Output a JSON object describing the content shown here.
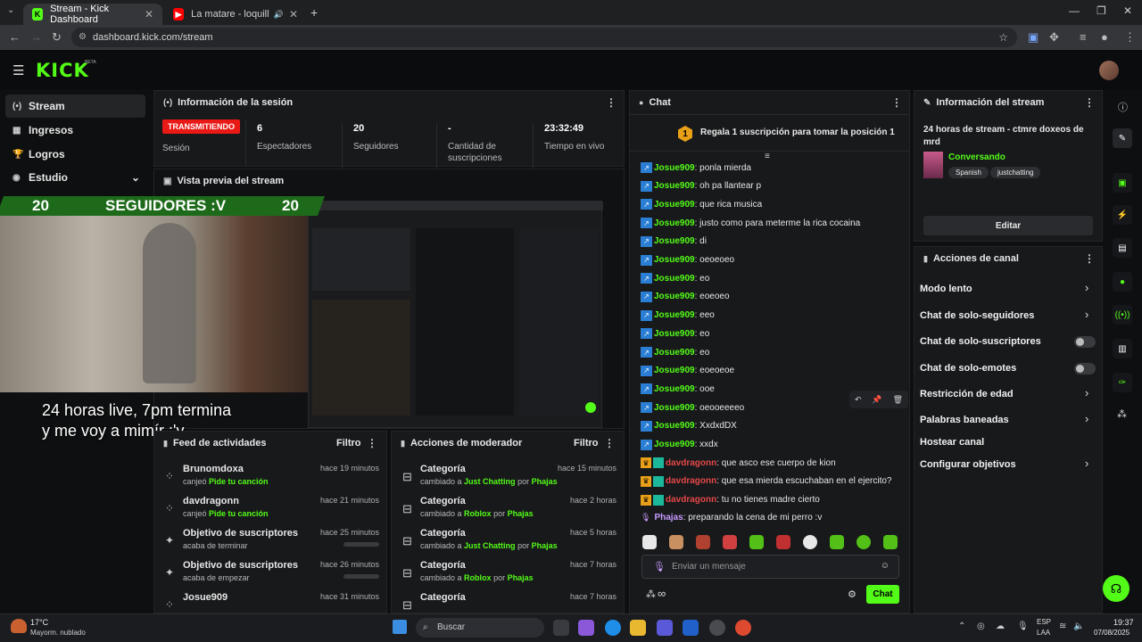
{
  "browser": {
    "tabs": [
      {
        "label": "Stream - Kick Dashboard",
        "icon": "kick-icon"
      },
      {
        "label": "La matare - loquillo y los tr",
        "icon": "youtube-icon"
      }
    ],
    "url": "dashboard.kick.com/stream"
  },
  "header": {
    "logo": "KICK",
    "beta": "BETA"
  },
  "sidebar": {
    "items": [
      {
        "label": "Stream",
        "icon": "stream-icon"
      },
      {
        "label": "Ingresos",
        "icon": "money-icon"
      },
      {
        "label": "Logros",
        "icon": "trophy-icon"
      },
      {
        "label": "Estudio",
        "icon": "studio-icon"
      }
    ]
  },
  "session": {
    "title": "Información de la sesión",
    "status": "TRANSMITIENDO",
    "status_label": "Sesión",
    "stats": [
      {
        "value": "6",
        "label": "Espectadores"
      },
      {
        "value": "20",
        "label": "Seguidores"
      },
      {
        "value": "-",
        "label": "Cantidad de suscripciones"
      },
      {
        "value": "23:32:49",
        "label": "Tiempo en vivo"
      }
    ]
  },
  "preview": {
    "title": "Vista previa del stream",
    "overlay_left": "20",
    "overlay_mid": "SEGUIDORES :V",
    "overlay_right": "20",
    "caption_line1": "24 horas live, 7pm termina",
    "caption_line2": "y me voy a mimír :'v"
  },
  "feed": {
    "title": "Feed de actividades",
    "filter": "Filtro",
    "items": [
      {
        "name": "Brunomdoxa",
        "sub_pre": "canjeó ",
        "sub_hl": "Pide tu canción",
        "time": "hace 19 minutos"
      },
      {
        "name": "davdragonn",
        "sub_pre": "canjeó ",
        "sub_hl": "Pide tu canción",
        "time": "hace 21 minutos"
      },
      {
        "name": "Objetivo de suscriptores",
        "sub_pre": "acaba de terminar",
        "sub_hl": "",
        "time": "hace 25 minutos"
      },
      {
        "name": "Objetivo de suscriptores",
        "sub_pre": "acaba de empezar",
        "sub_hl": "",
        "time": "hace 26 minutos"
      },
      {
        "name": "Josue909",
        "sub_pre": "",
        "sub_hl": "",
        "time": "hace 31 minutos"
      }
    ]
  },
  "modactions": {
    "title": "Acciones de moderador",
    "filter": "Filtro",
    "items": [
      {
        "name": "Categoría",
        "cat": "Just Chatting",
        "by": "Phajas",
        "time": "hace 15 minutos"
      },
      {
        "name": "Categoría",
        "cat": "Roblox",
        "by": "Phajas",
        "time": "hace 2 horas"
      },
      {
        "name": "Categoría",
        "cat": "Just Chatting",
        "by": "Phajas",
        "time": "hace 5 horas"
      },
      {
        "name": "Categoría",
        "cat": "Roblox",
        "by": "Phajas",
        "time": "hace 7 horas"
      },
      {
        "name": "Categoría",
        "cat": "",
        "by": "",
        "time": "hace 7 horas"
      }
    ],
    "changed_to": "cambiado a",
    "by_word": "por"
  },
  "chat": {
    "title": "Chat",
    "pinned_rank": "1",
    "pinned": "Regala 1 suscripción para tomar la posición 1",
    "messages": [
      {
        "user": "Josue909",
        "text": "ponla mierda",
        "kind": "k"
      },
      {
        "user": "Josue909",
        "text": "oh pa llantear p",
        "kind": "k"
      },
      {
        "user": "Josue909",
        "text": "que rica musica",
        "kind": "k"
      },
      {
        "user": "Josue909",
        "text": "justo como para meterme la rica cocaina",
        "kind": "k"
      },
      {
        "user": "Josue909",
        "text": "di",
        "kind": "k"
      },
      {
        "user": "Josue909",
        "text": "oeoeoeo",
        "kind": "k"
      },
      {
        "user": "Josue909",
        "text": "eo",
        "kind": "k"
      },
      {
        "user": "Josue909",
        "text": "eoeoeo",
        "kind": "k"
      },
      {
        "user": "Josue909",
        "text": "eeo",
        "kind": "k"
      },
      {
        "user": "Josue909",
        "text": "eo",
        "kind": "k"
      },
      {
        "user": "Josue909",
        "text": "eo",
        "kind": "k"
      },
      {
        "user": "Josue909",
        "text": "eoeoeoe",
        "kind": "k"
      },
      {
        "user": "Josue909",
        "text": "ooe",
        "kind": "k"
      },
      {
        "user": "Josue909",
        "text": "oeooeeeeo",
        "kind": "k"
      },
      {
        "user": "Josue909",
        "text": "XxdxdDX",
        "kind": "k"
      },
      {
        "user": "Josue909",
        "text": "xxdx",
        "kind": "k"
      },
      {
        "user": "davdragonn",
        "text": "que asco ese cuerpo de kion",
        "kind": "d"
      },
      {
        "user": "davdragonn",
        "text": "que esa mierda escuchaban en el ejercito?",
        "kind": "d"
      },
      {
        "user": "davdragonn",
        "text": "tu no tienes madre cierto",
        "kind": "d"
      },
      {
        "user": "Phajas",
        "text": "preparando la cena de mi perro :v",
        "kind": "p"
      }
    ],
    "input_placeholder": "Enviar un mensaje",
    "send": "Chat",
    "infinity": "∞"
  },
  "streaminfo": {
    "title": "Información del stream",
    "stream_title": "24 horas de stream - ctmre doxeos de mrd",
    "category": "Conversando",
    "tags": [
      "Spanish",
      "justchatting"
    ],
    "edit": "Editar"
  },
  "channel": {
    "title": "Acciones de canal",
    "rows": [
      {
        "label": "Modo lento",
        "control": "chevron"
      },
      {
        "label": "Chat de solo-seguidores",
        "control": "chevron"
      },
      {
        "label": "Chat de solo-suscriptores",
        "control": "toggle"
      },
      {
        "label": "Chat de solo-emotes",
        "control": "toggle"
      },
      {
        "label": "Restricción de edad",
        "control": "chevron"
      },
      {
        "label": "Palabras baneadas",
        "control": "chevron"
      },
      {
        "label": "Hostear canal",
        "control": "none"
      },
      {
        "label": "Configurar objetivos",
        "control": "chevron"
      }
    ]
  },
  "taskbar": {
    "weather_temp": "17°C",
    "weather_desc": "Mayorm. nublado",
    "search": "Buscar",
    "lang1": "ESP",
    "lang2": "LAA",
    "time": "19:37",
    "date": "07/08/2025"
  },
  "colors": {
    "accent": "#53fc18",
    "live": "#e91916"
  }
}
